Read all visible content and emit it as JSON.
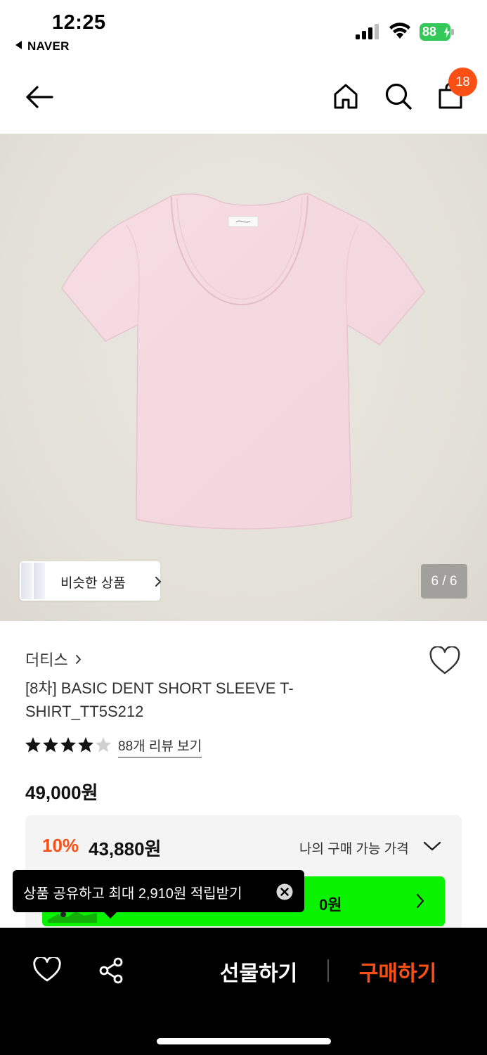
{
  "status_bar": {
    "time": "12:25",
    "back_app": "NAVER",
    "battery": "88"
  },
  "header": {
    "icons": [
      "back-arrow-icon",
      "home-icon",
      "search-icon",
      "shopping-bag-icon"
    ],
    "cart_count": "18"
  },
  "gallery": {
    "similar_label": "비슷한 상품",
    "page_indicator": "6 / 6"
  },
  "product": {
    "brand": "더티스",
    "title": "[8차] BASIC DENT SHORT SLEEVE T-SHIRT_TT5S212",
    "rating_stars": 4.5,
    "review_link": "88개 리뷰 보기",
    "original_price": "49,000원"
  },
  "price_box": {
    "discount_rate": "10%",
    "discount_price": "43,880원",
    "my_price_label": "나의 구매 가능 가격",
    "banner_value": "0원"
  },
  "tooltip": {
    "text": "상품 공유하고 최대 2,910원 적립받기"
  },
  "bottom_bar": {
    "gift_label": "선물하기",
    "buy_label": "구매하기"
  },
  "colors": {
    "accent": "#fa4f15",
    "banner_green": "#09f200",
    "battery_green": "#34c759",
    "product_pink": "#f4d8df"
  }
}
